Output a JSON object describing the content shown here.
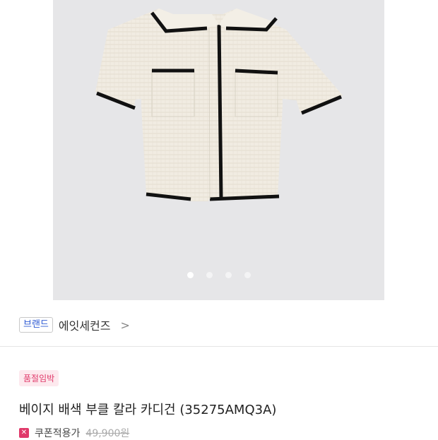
{
  "gallery": {
    "image_alt": "cardigan-product-photo",
    "slide_count": 4,
    "active_index": 0
  },
  "brand": {
    "tag_label": "브랜드",
    "name": "에잇세컨즈",
    "chevron": ">"
  },
  "product": {
    "status_badge": "품절임박",
    "title": "베이지 배색 부클 칼라 카디건 (35275AMQ3A)",
    "coupon_icon": "coupon-icon",
    "coupon_label": "쿠폰적용가",
    "original_price": "49,900원"
  },
  "colors": {
    "brand_tag": "#2f5bd3",
    "badge_text": "#e0396a",
    "badge_bg": "#fde9ee"
  }
}
